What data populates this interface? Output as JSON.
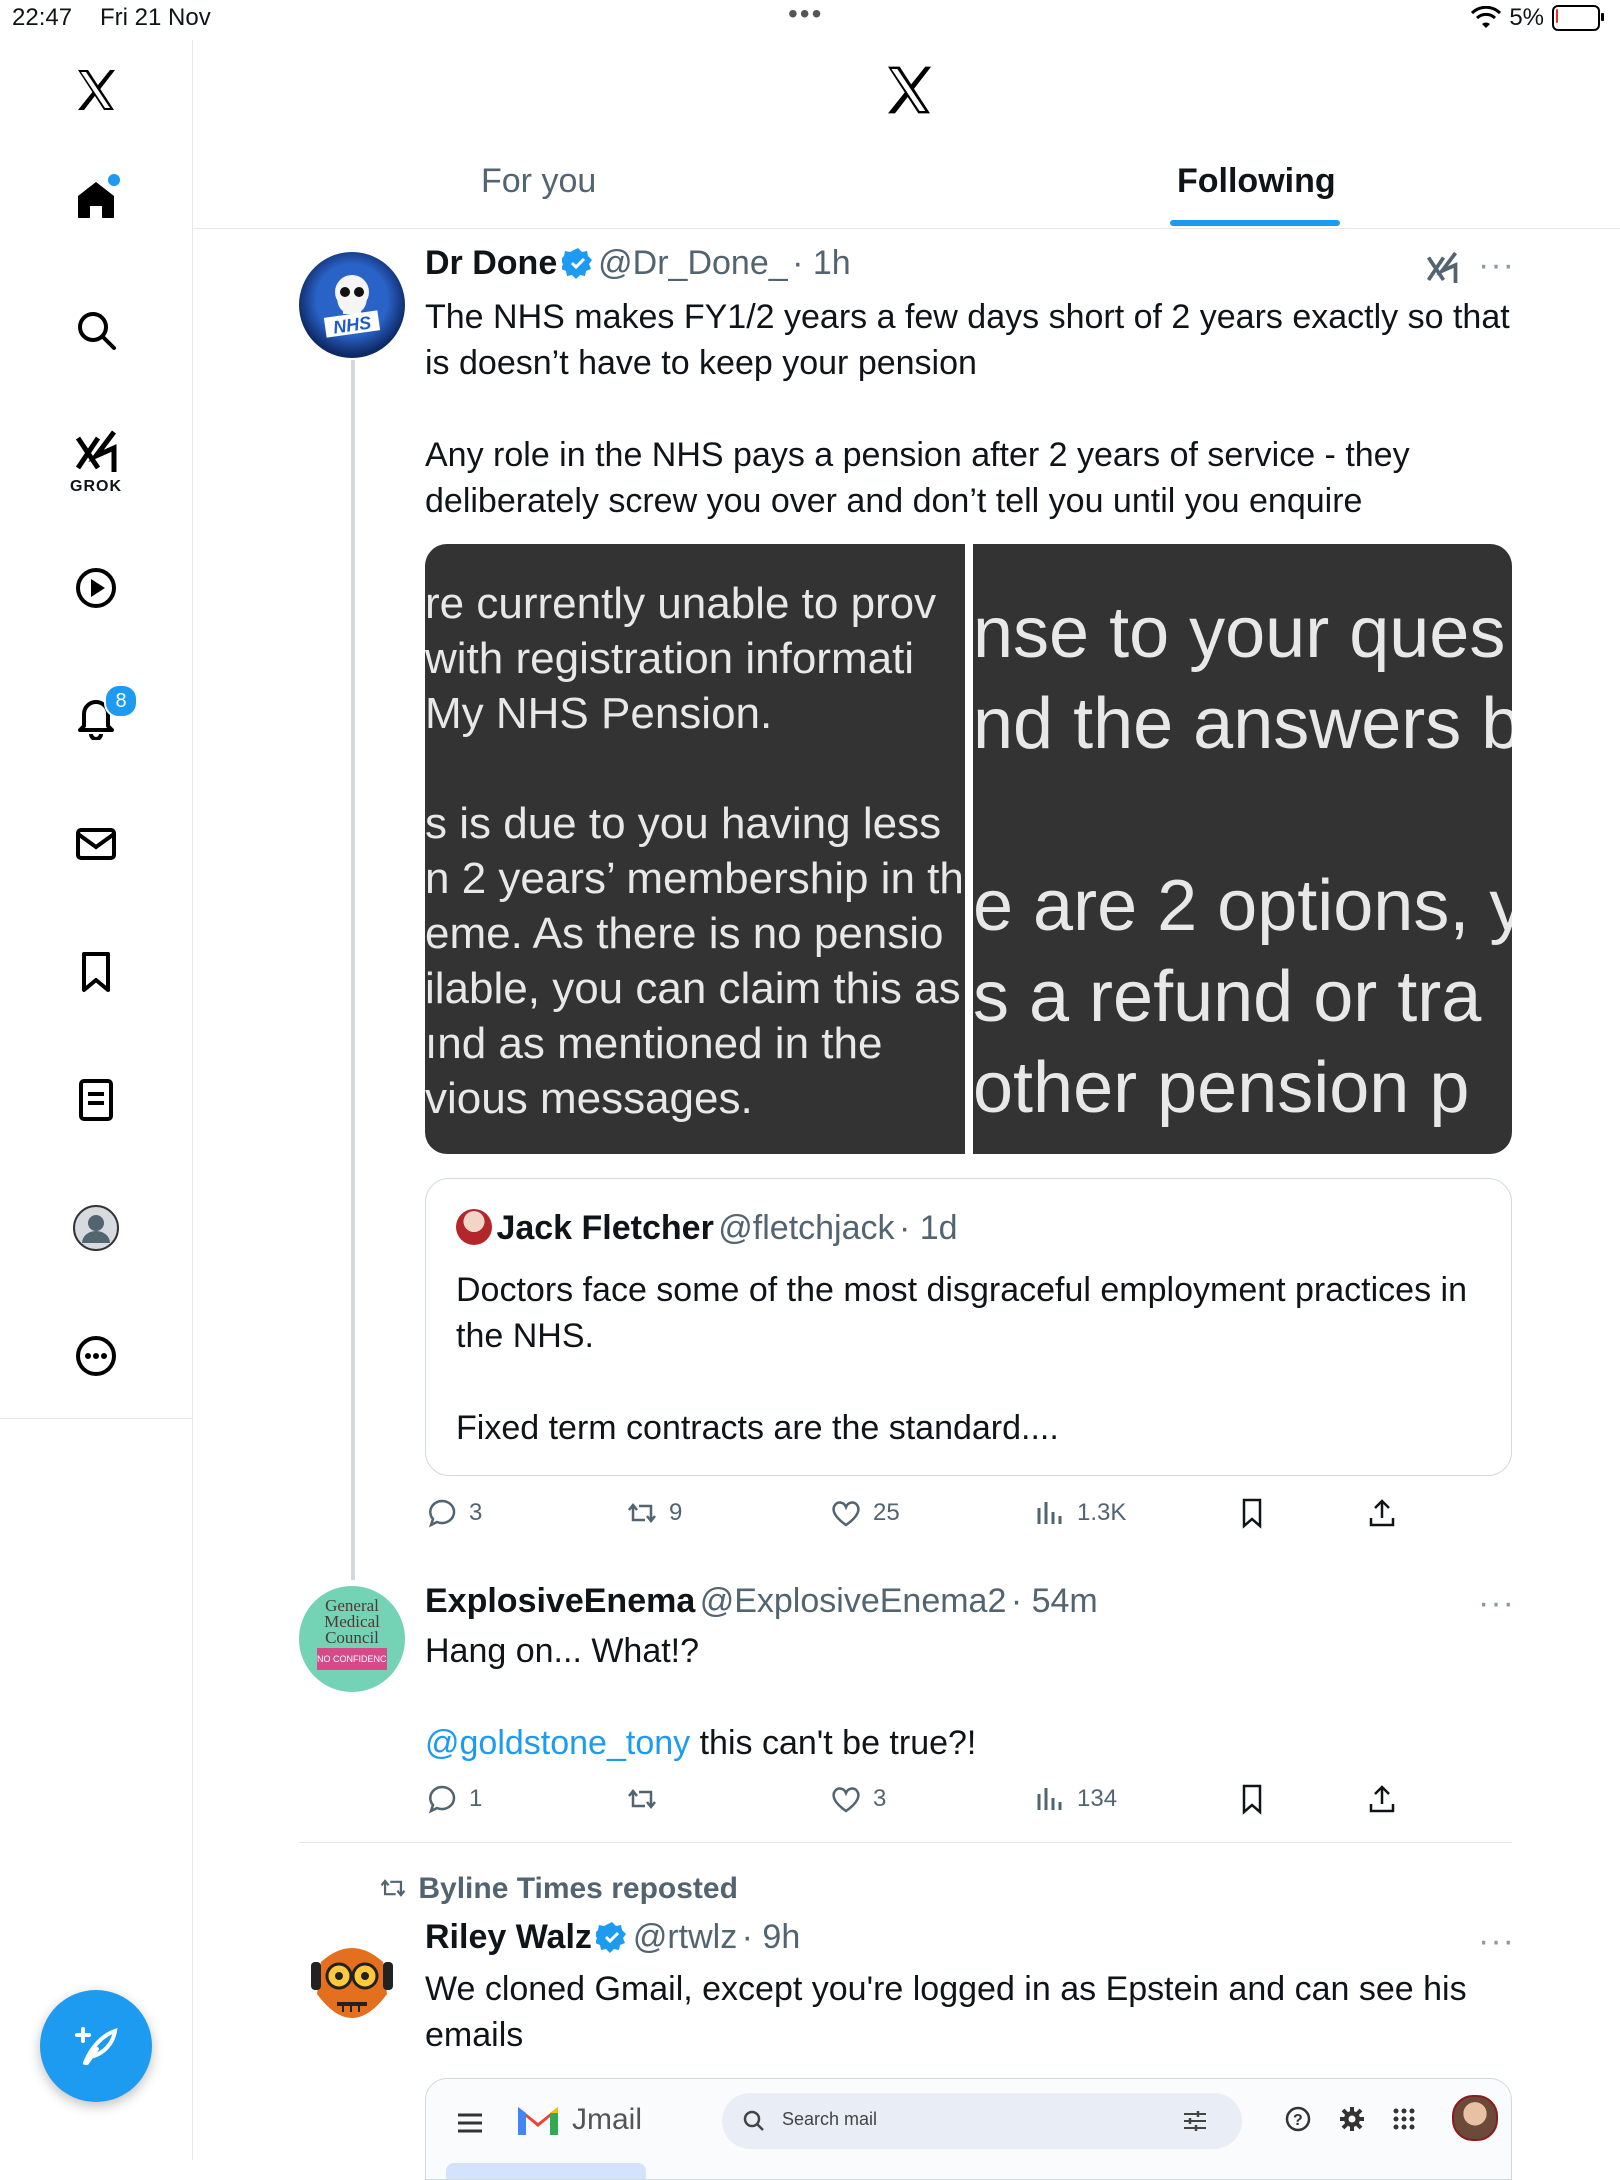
{
  "status_bar": {
    "time": "22:47",
    "date": "Fri 21 Nov",
    "battery": "5%",
    "battery_level": 0.05
  },
  "sidebar": {
    "grok_label": "GROK",
    "notifications_badge": "8",
    "items": [
      "x-logo",
      "home",
      "search",
      "grok",
      "video",
      "notifications",
      "messages",
      "bookmarks",
      "lists",
      "profile",
      "more"
    ]
  },
  "header": {
    "tabs": [
      {
        "label": "For you"
      },
      {
        "label": "Following"
      }
    ],
    "active_tab": "Following"
  },
  "colors": {
    "accent": "#1d9bf0",
    "text": "#0f1419",
    "muted": "#536471",
    "image_bg": "#333333"
  },
  "tweets": [
    {
      "name": "Dr Done",
      "handle": "@Dr_Done_",
      "time": "· 1h",
      "verified": true,
      "lines": [
        "The NHS makes FY1/2 years a few days short of 2 years exactly so that",
        "is doesn’t have to keep your pension",
        "Any role in the NHS pays a pension after 2 years of service - they",
        "deliberately screw you over and don’t tell you until you enquire"
      ],
      "image_left_lines": [
        "re currently unable to prov",
        " with registration informati",
        "My NHS Pension.",
        "",
        "s is due to you having less",
        "n 2 years’ membership in th",
        "eme. As there is no pensio",
        "ilable, you can claim this as",
        "ınd as mentioned in the",
        "vious messages."
      ],
      "image_right_lines": [
        "nse to your ques",
        "nd the answers b",
        "",
        "e are 2 options, y",
        "s a refund or tra",
        "other pension p"
      ],
      "quote": {
        "name": "Jack Fletcher",
        "handle": "@fletchjack",
        "time": "· 1d",
        "lines": [
          "Doctors face some of the most disgraceful employment practices in",
          "the NHS.",
          "Fixed term contracts are the standard...."
        ]
      },
      "stats": {
        "replies": "3",
        "reposts": "9",
        "likes": "25",
        "views": "1.3K"
      }
    },
    {
      "name": "ExplosiveEnema",
      "handle": "@ExplosiveEnema2",
      "time": "· 54m",
      "avatar_lines": [
        "General",
        "Medical",
        "Council",
        "NO CONFIDENCE"
      ],
      "line1": "Hang on... What!?",
      "mention": "@goldstone_tony",
      "line2_rest": " this can't be true?!",
      "stats": {
        "replies": "1",
        "reposts": "",
        "likes": "3",
        "views": "134"
      }
    },
    {
      "repost_label": "Byline Times reposted",
      "name": "Riley Walz",
      "handle": "@rtwlz",
      "time": "· 9h",
      "verified": true,
      "lines": [
        "We cloned Gmail, except you're logged in as Epstein and can see his",
        "emails"
      ],
      "embed": {
        "app_name": "Jmail",
        "search_placeholder": "Search mail"
      }
    }
  ]
}
